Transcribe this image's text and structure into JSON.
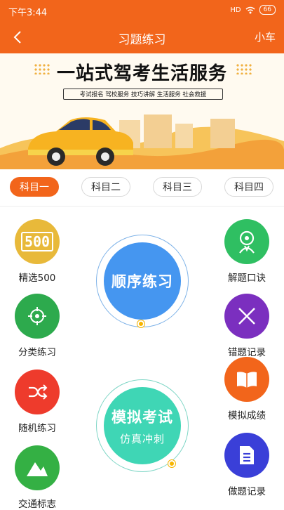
{
  "status": {
    "time": "下午3:44",
    "signal": "HD",
    "battery": "66"
  },
  "nav": {
    "title": "习题练习",
    "right": "小车"
  },
  "banner": {
    "title": "一站式驾考生活服务",
    "tags": "考试报名  驾校服务  技巧讲解  生活服务  社会救援"
  },
  "tabs": [
    "科目一",
    "科目二",
    "科目三",
    "科目四"
  ],
  "features_left": [
    {
      "label": "精选500",
      "icon_text": "500",
      "color": "#e8b93a"
    },
    {
      "label": "分类练习",
      "color": "#2daa4d"
    },
    {
      "label": "随机练习",
      "color": "#ee3b2c"
    },
    {
      "label": "交通标志",
      "color": "#34b044"
    }
  ],
  "features_right": [
    {
      "label": "解题口诀",
      "color": "#2fbf62"
    },
    {
      "label": "错题记录",
      "color": "#7b2fbf"
    },
    {
      "label": "模拟成绩",
      "color": "#f2651b"
    },
    {
      "label": "做题记录",
      "color": "#3a3fd8"
    }
  ],
  "center": {
    "sequence": {
      "title": "顺序练习",
      "color": "#4596f0"
    },
    "mock": {
      "title": "模拟考试",
      "subtitle": "仿真冲刺",
      "color": "#3fd6b5"
    }
  }
}
